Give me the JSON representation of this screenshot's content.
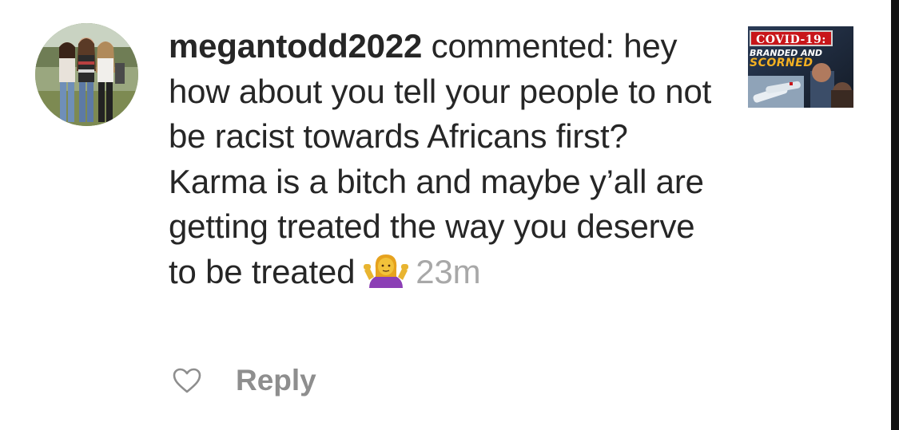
{
  "comment": {
    "username": "megantodd2022",
    "action_text": " commented: ",
    "body": "hey how about you tell your people to not be racist towards Africans first? Karma is a bitch and maybe y’all are getting treated the way you deserve to be treated",
    "emoji_icon": "person-shrugging-emoji",
    "timestamp": "23m"
  },
  "thumbnail": {
    "title": "COVID-19:",
    "subtitle_line1": "BRANDED AND",
    "subtitle_line2": "SCORNED"
  },
  "actions": {
    "like_icon": "heart-icon",
    "reply_label": "Reply"
  },
  "colors": {
    "text": "#262626",
    "timestamp": "#a8a8a8",
    "reply": "#8e8e8e",
    "thumb_red": "#c8161a",
    "thumb_gold": "#f3b022"
  }
}
